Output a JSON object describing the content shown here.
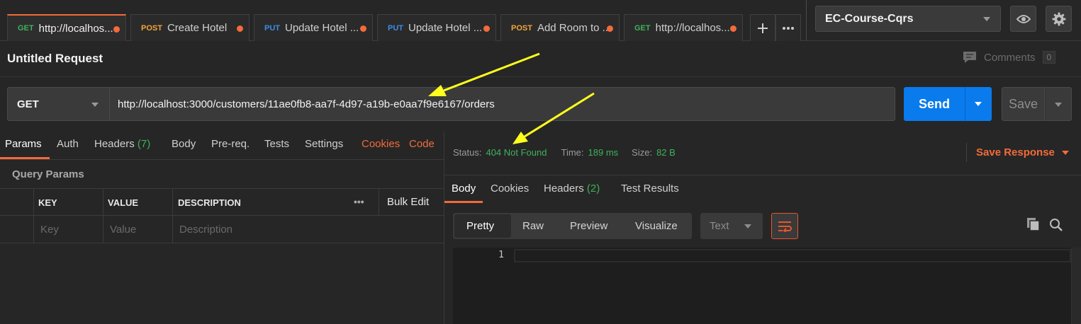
{
  "tabs": [
    {
      "method": "GET",
      "method_color": "#3eb25a",
      "name": "http://localhos...",
      "active": true
    },
    {
      "method": "POST",
      "method_color": "#f2a63c",
      "name": "Create Hotel"
    },
    {
      "method": "PUT",
      "method_color": "#3a8ee6",
      "name": "Update Hotel ..."
    },
    {
      "method": "PUT",
      "method_color": "#3a8ee6",
      "name": "Update Hotel ..."
    },
    {
      "method": "POST",
      "method_color": "#f2a63c",
      "name": "Add Room to ..."
    },
    {
      "method": "GET",
      "method_color": "#3eb25a",
      "name": "http://localhos..."
    }
  ],
  "tab_dot_color": "#f26b3a",
  "environment": {
    "selected": "EC-Course-Cqrs"
  },
  "request": {
    "title": "Untitled Request",
    "comments_label": "Comments",
    "comments_count": "0",
    "method": "GET",
    "url": "http://localhost:3000/customers/11ae0fb8-aa7f-4d97-a19b-e0aa7f9e6167/orders",
    "send_label": "Send",
    "save_label": "Save"
  },
  "request_tabs": {
    "params": "Params",
    "auth": "Auth",
    "headers": "Headers",
    "headers_count": "(7)",
    "body": "Body",
    "prereq": "Pre-req.",
    "tests": "Tests",
    "settings": "Settings",
    "cookies": "Cookies",
    "code": "Code"
  },
  "query_params": {
    "title": "Query Params",
    "columns": [
      "KEY",
      "VALUE",
      "DESCRIPTION"
    ],
    "more": "•••",
    "bulk_edit": "Bulk Edit",
    "placeholders": [
      "Key",
      "Value",
      "Description"
    ]
  },
  "response": {
    "status_label": "Status:",
    "status_value": "404 Not Found",
    "time_label": "Time:",
    "time_value": "189 ms",
    "size_label": "Size:",
    "size_value": "82 B",
    "save_response": "Save Response",
    "tabs": {
      "body": "Body",
      "cookies": "Cookies",
      "headers": "Headers",
      "headers_count": "(2)",
      "test_results": "Test Results"
    },
    "views": [
      "Pretty",
      "Raw",
      "Preview",
      "Visualize"
    ],
    "format": "Text",
    "line_numbers": [
      "1"
    ]
  },
  "annotations": {
    "arrow_color": "#ffff1e",
    "arrow_count": 2
  }
}
